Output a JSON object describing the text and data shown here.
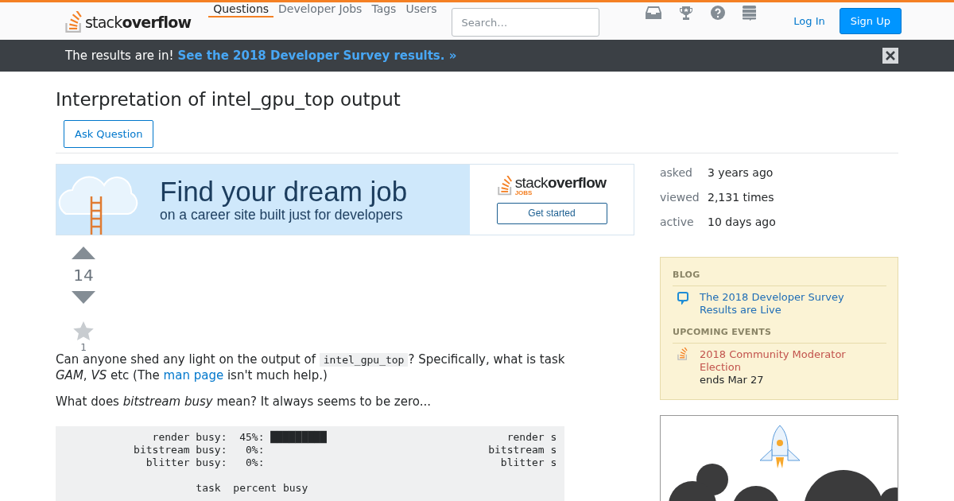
{
  "header": {
    "logo": "stack**overflow**",
    "nav": [
      {
        "label": "Questions",
        "selected": true
      },
      {
        "label": "Developer Jobs",
        "selected": false
      },
      {
        "label": "Tags",
        "selected": false
      },
      {
        "label": "Users",
        "selected": false
      }
    ],
    "search": {
      "placeholder": "Search…"
    },
    "login": "Log In",
    "signup": "Sign Up"
  },
  "banner": {
    "text": "The results are in!",
    "link": "See the 2018 Developer Survey results. »"
  },
  "question": {
    "title": "Interpretation of intel_gpu_top output",
    "ask_button": "Ask Question",
    "votes": "14",
    "favorites": "1",
    "paragraphs": [
      {
        "segments": [
          {
            "kind": "text",
            "text": "Can anyone shed any light on the output of "
          },
          {
            "kind": "code",
            "text": "intel_gpu_top"
          },
          {
            "kind": "text",
            "text": "? Specifically, what is task *GAM*, *VS* etc (The "
          },
          {
            "kind": "link",
            "text": "man page"
          },
          {
            "kind": "text",
            "text": " isn't much help.)"
          }
        ]
      },
      {
        "segments": [
          {
            "kind": "text",
            "text": "What does *bitstream busy* mean? It always seems to be zero..."
          }
        ]
      }
    ],
    "code": [
      {
        "lines": [
          "              render busy:  45%: █████████                             render s",
          "           bitstream busy:   0%:                                    bitstream s",
          "             blitter busy:   0%:                                      blitter s"
        ]
      },
      {
        "lines": [
          "                     task  percent busy"
        ]
      }
    ]
  },
  "ad": {
    "headline": "Find your dream job",
    "subline": "on a career site built just for developers",
    "logo": "stack**overflow**",
    "logo_sub": "JOBS",
    "button": "Get started"
  },
  "stats": [
    {
      "label": "asked",
      "value": "3 years ago"
    },
    {
      "label": "viewed",
      "value": "2,131 times"
    },
    {
      "label": "active",
      "value": "10 days ago"
    }
  ],
  "sidebar_box": {
    "sections": [
      {
        "heading": "BLOG",
        "items": [
          {
            "kind": "blog",
            "title": "The 2018 Developer Survey Results are Live"
          }
        ]
      },
      {
        "heading": "UPCOMING EVENTS",
        "items": [
          {
            "kind": "event",
            "title": "2018 Community Moderator Election",
            "note": "ends Mar 27"
          }
        ]
      }
    ]
  }
}
